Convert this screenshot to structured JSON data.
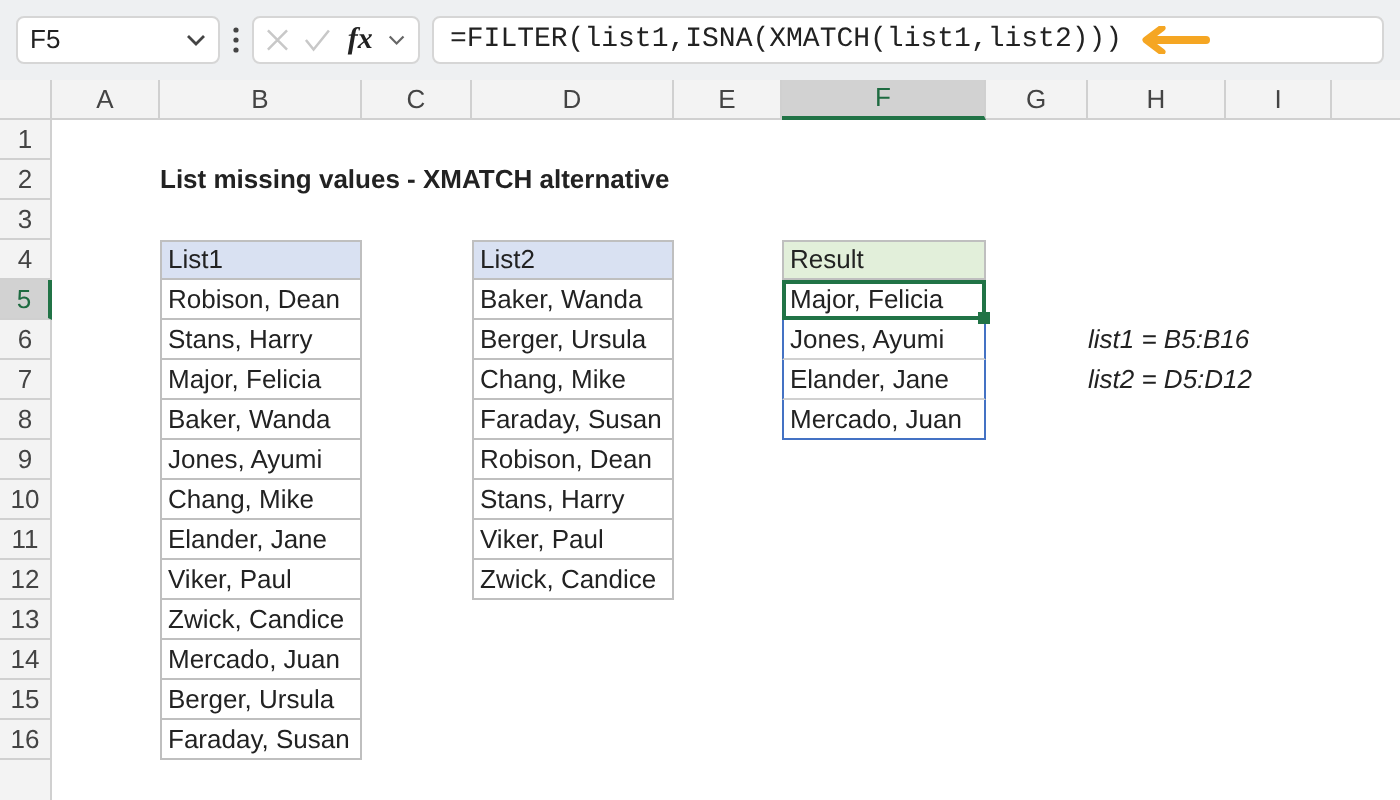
{
  "name_box": "F5",
  "function_button": "fx",
  "formula": "=FILTER(list1,ISNA(XMATCH(list1,list2)))",
  "columns": [
    {
      "label": "A",
      "selected": false
    },
    {
      "label": "B",
      "selected": false
    },
    {
      "label": "C",
      "selected": false
    },
    {
      "label": "D",
      "selected": false
    },
    {
      "label": "E",
      "selected": false
    },
    {
      "label": "F",
      "selected": true
    },
    {
      "label": "G",
      "selected": false
    },
    {
      "label": "H",
      "selected": false
    },
    {
      "label": "I",
      "selected": false
    }
  ],
  "rows": [
    {
      "label": "1",
      "selected": false
    },
    {
      "label": "2",
      "selected": false
    },
    {
      "label": "3",
      "selected": false
    },
    {
      "label": "4",
      "selected": false
    },
    {
      "label": "5",
      "selected": true
    },
    {
      "label": "6",
      "selected": false
    },
    {
      "label": "7",
      "selected": false
    },
    {
      "label": "8",
      "selected": false
    },
    {
      "label": "9",
      "selected": false
    },
    {
      "label": "10",
      "selected": false
    },
    {
      "label": "11",
      "selected": false
    },
    {
      "label": "12",
      "selected": false
    },
    {
      "label": "13",
      "selected": false
    },
    {
      "label": "14",
      "selected": false
    },
    {
      "label": "15",
      "selected": false
    },
    {
      "label": "16",
      "selected": false
    }
  ],
  "title": "List missing values - XMATCH alternative",
  "tables": [
    {
      "kind": "input",
      "header": "List1",
      "items": [
        {
          "text": "Robison, Dean",
          "selected": false
        },
        {
          "text": "Stans, Harry",
          "selected": false
        },
        {
          "text": "Major, Felicia",
          "selected": false
        },
        {
          "text": "Baker, Wanda",
          "selected": false
        },
        {
          "text": "Jones, Ayumi",
          "selected": false
        },
        {
          "text": "Chang, Mike",
          "selected": false
        },
        {
          "text": "Elander, Jane",
          "selected": false
        },
        {
          "text": "Viker, Paul",
          "selected": false
        },
        {
          "text": "Zwick, Candice",
          "selected": false
        },
        {
          "text": "Mercado, Juan",
          "selected": false
        },
        {
          "text": "Berger, Ursula",
          "selected": false
        },
        {
          "text": "Faraday, Susan",
          "selected": false
        }
      ]
    },
    {
      "kind": "input",
      "header": "List2",
      "items": [
        {
          "text": "Baker, Wanda",
          "selected": false
        },
        {
          "text": "Berger, Ursula",
          "selected": false
        },
        {
          "text": "Chang, Mike",
          "selected": false
        },
        {
          "text": "Faraday, Susan",
          "selected": false
        },
        {
          "text": "Robison, Dean",
          "selected": false
        },
        {
          "text": "Stans, Harry",
          "selected": false
        },
        {
          "text": "Viker, Paul",
          "selected": false
        },
        {
          "text": "Zwick, Candice",
          "selected": false
        }
      ]
    },
    {
      "kind": "spill",
      "header": "Result",
      "items": [
        {
          "text": "Major, Felicia",
          "selected": true
        },
        {
          "text": "Jones, Ayumi",
          "selected": false
        },
        {
          "text": "Elander, Jane",
          "selected": false
        },
        {
          "text": "Mercado, Juan",
          "selected": false
        }
      ]
    }
  ],
  "notes": [
    "list1 = B5:B16",
    "list2 = D5:D12"
  ]
}
